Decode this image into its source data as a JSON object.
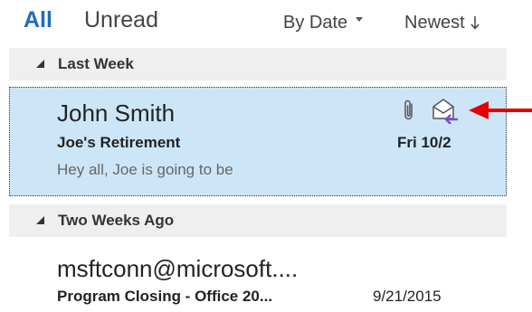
{
  "filters": {
    "all_label": "All",
    "unread_label": "Unread",
    "sort_label": "By Date",
    "order_label": "Newest"
  },
  "groups": [
    {
      "label": "Last Week"
    },
    {
      "label": "Two Weeks Ago"
    }
  ],
  "messages": [
    {
      "sender": "John Smith",
      "subject": "Joe's Retirement",
      "preview": "Hey all,   Joe is going to be",
      "date": "Fri 10/2",
      "selected": true,
      "icons": [
        "paperclip-icon",
        "envelope-forward-icon"
      ]
    },
    {
      "sender": "msftconn@microsoft....",
      "subject": "Program Closing - Office 20...",
      "date": "9/21/2015"
    }
  ],
  "colors": {
    "accent": "#1f6bc3",
    "selected_bg": "#cde6f7",
    "forward_arrow": "#7a4fbf",
    "pointer_arrow": "#e60000"
  }
}
